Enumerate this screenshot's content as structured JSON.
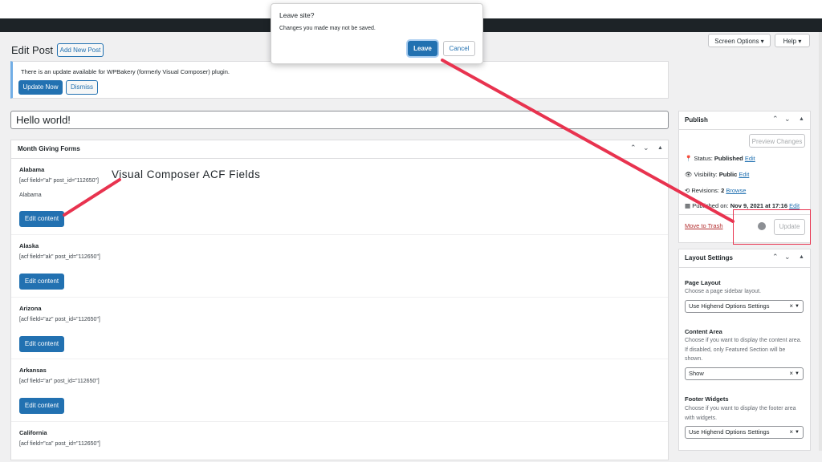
{
  "dialog": {
    "title": "Leave site?",
    "message": "Changes you made may not be saved.",
    "leave": "Leave",
    "cancel": "Cancel"
  },
  "screen_meta": {
    "screen_options": "Screen Options ▾",
    "help": "Help ▾"
  },
  "header": {
    "title": "Edit Post",
    "add_new": "Add New Post"
  },
  "notice": {
    "text": "There is an update available for WPBakery (formerly Visual Composer) plugin.",
    "update_now": "Update Now",
    "dismiss": "Dismiss"
  },
  "post_title": "Hello world!",
  "month_giving": {
    "title": "Month Giving Forms",
    "edit_label": "Edit content",
    "states": [
      {
        "name": "Alabama",
        "shortcode": "[acf field=\"al\" post_id=\"112650\"]",
        "extra": "Alabama"
      },
      {
        "name": "Alaska",
        "shortcode": "[acf field=\"ak\" post_id=\"112650\"]"
      },
      {
        "name": "Arizona",
        "shortcode": "[acf field=\"az\" post_id=\"112650\"]"
      },
      {
        "name": "Arkansas",
        "shortcode": "[acf field=\"ar\" post_id=\"112650\"]"
      },
      {
        "name": "California",
        "shortcode": "[acf field=\"ca\" post_id=\"112650\"]"
      }
    ]
  },
  "annotation": "Visual Composer ACF Fields",
  "publish": {
    "title": "Publish",
    "preview": "Preview Changes",
    "status_label": "Status:",
    "status_value": "Published",
    "status_edit": "Edit",
    "visibility_label": "Visibility:",
    "visibility_value": "Public",
    "visibility_edit": "Edit",
    "revisions_label": "Revisions:",
    "revisions_value": "2",
    "revisions_browse": "Browse",
    "published_label": "Published on:",
    "published_value": "Nov 9, 2021 at 17:16",
    "published_edit": "Edit",
    "trash": "Move to Trash",
    "update": "Update"
  },
  "layout_settings": {
    "title": "Layout Settings",
    "page_layout_label": "Page Layout",
    "page_layout_desc": "Choose a page sidebar layout.",
    "page_layout_value": "Use Highend Options Settings",
    "content_area_label": "Content Area",
    "content_area_desc": "Choose if you want to display the content area. If disabled, only Featured Section will be shown.",
    "content_area_value": "Show",
    "footer_widgets_label": "Footer Widgets",
    "footer_widgets_desc": "Choose if you want to display the footer area with widgets.",
    "footer_widgets_value": "Use Highend Options Settings"
  },
  "colors": {
    "primary": "#2271b1",
    "arrow": "#e8334f",
    "admin_bar": "#1d2327"
  },
  "icons": {
    "pin": "pin-icon",
    "eye": "eye-icon",
    "revisions": "clock-icon",
    "calendar": "calendar-icon",
    "spinner": "spinner-icon"
  }
}
